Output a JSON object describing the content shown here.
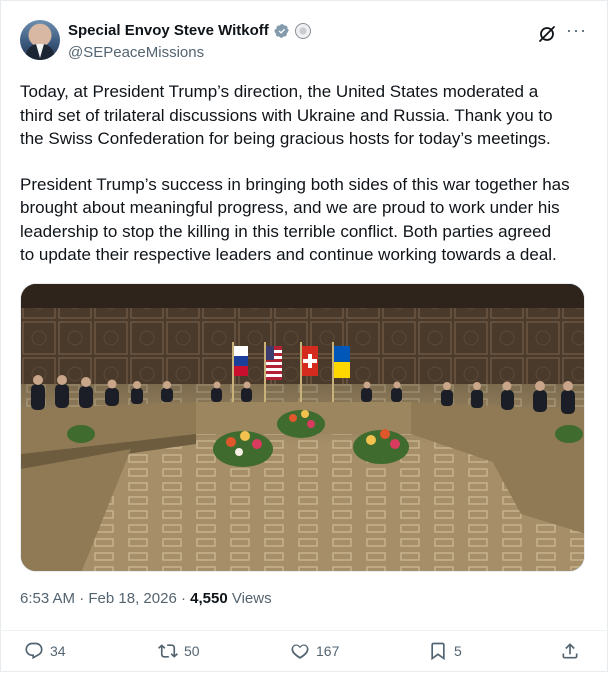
{
  "author": {
    "display_name": "Special Envoy Steve Witkoff",
    "handle": "@SEPeaceMissions"
  },
  "post": {
    "paragraphs": [
      "Today, at President Trump’s direction, the United States moderated a\nthird set of trilateral discussions with Ukraine and Russia. Thank you to\nthe Swiss Confederation for being gracious hosts for today’s meetings.",
      "President Trump’s success in bringing both sides of this war together has\nbrought about meaningful progress, and we are proud to work under his\nleadership to stop the killing in this terrible conflict. Both parties agreed\nto update their respective leaders and continue working towards a deal."
    ],
    "time": "6:53 AM",
    "date": "Feb 18, 2026",
    "separator": "·",
    "views": "4,550",
    "views_label": "Views"
  },
  "actions": {
    "replies": "34",
    "reposts": "50",
    "likes": "167",
    "bookmarks": "5"
  },
  "icons": {
    "verified": "verified-badge-icon",
    "gov": "government-seal-icon",
    "grok": "grok-icon",
    "more": "more-icon"
  },
  "colors": {
    "verified": "#829aab",
    "secondary_text": "#536471",
    "primary_text": "#0f1419"
  }
}
